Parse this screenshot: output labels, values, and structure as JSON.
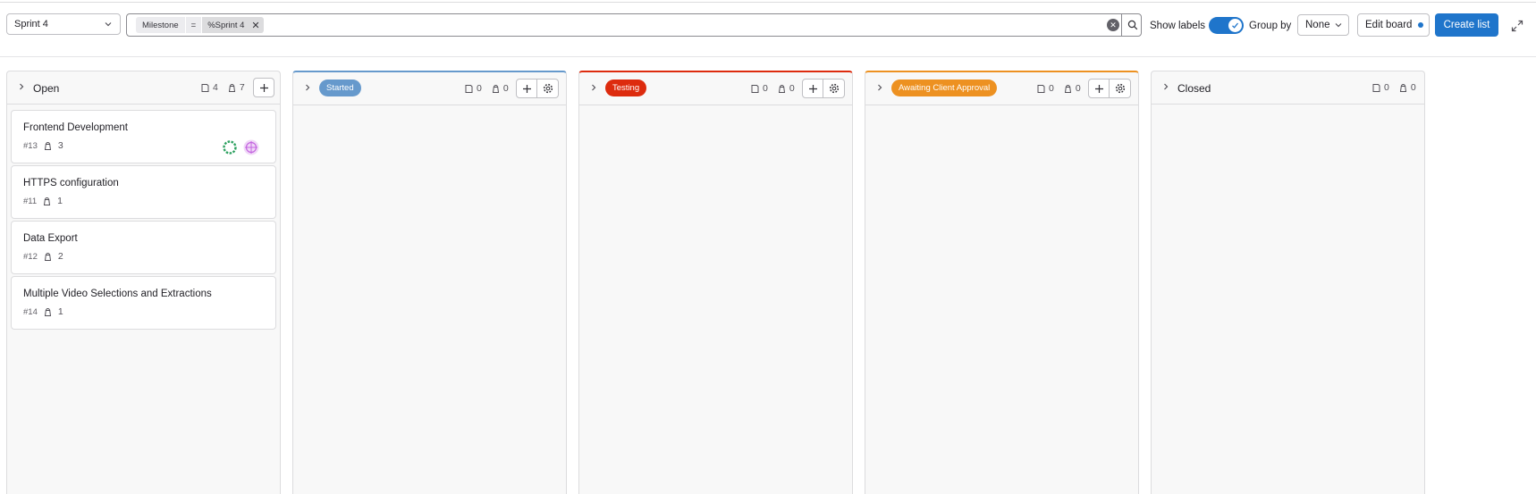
{
  "board_selector": {
    "value": "Sprint 4"
  },
  "filter": {
    "token_field": "Milestone",
    "token_operator": "=",
    "token_value": "%Sprint 4"
  },
  "toolbar": {
    "show_labels": "Show labels",
    "show_labels_on": true,
    "group_by": "Group by",
    "group_by_value": "None",
    "edit_board": "Edit board",
    "create_list": "Create list"
  },
  "colors": {
    "primary": "#1f75cb",
    "started": "#6699cc",
    "testing": "#dd2b0e",
    "awaiting": "#ed9121"
  },
  "lists": [
    {
      "title": "Open",
      "issues_count": "4",
      "weight": "7",
      "cards": [
        {
          "title": "Frontend Development",
          "number": "#13",
          "weight": "3"
        },
        {
          "title": "HTTPS configuration",
          "number": "#11",
          "weight": "1"
        },
        {
          "title": "Data Export",
          "number": "#12",
          "weight": "2"
        },
        {
          "title": "Multiple Video Selections and Extractions",
          "number": "#14",
          "weight": "1"
        }
      ]
    },
    {
      "title": "Started",
      "issues_count": "0",
      "weight": "0",
      "cards": []
    },
    {
      "title": "Testing",
      "issues_count": "0",
      "weight": "0",
      "cards": []
    },
    {
      "title": "Awaiting Client Approval",
      "issues_count": "0",
      "weight": "0",
      "cards": []
    },
    {
      "title": "Closed",
      "issues_count": "0",
      "weight": "0",
      "cards": []
    }
  ]
}
